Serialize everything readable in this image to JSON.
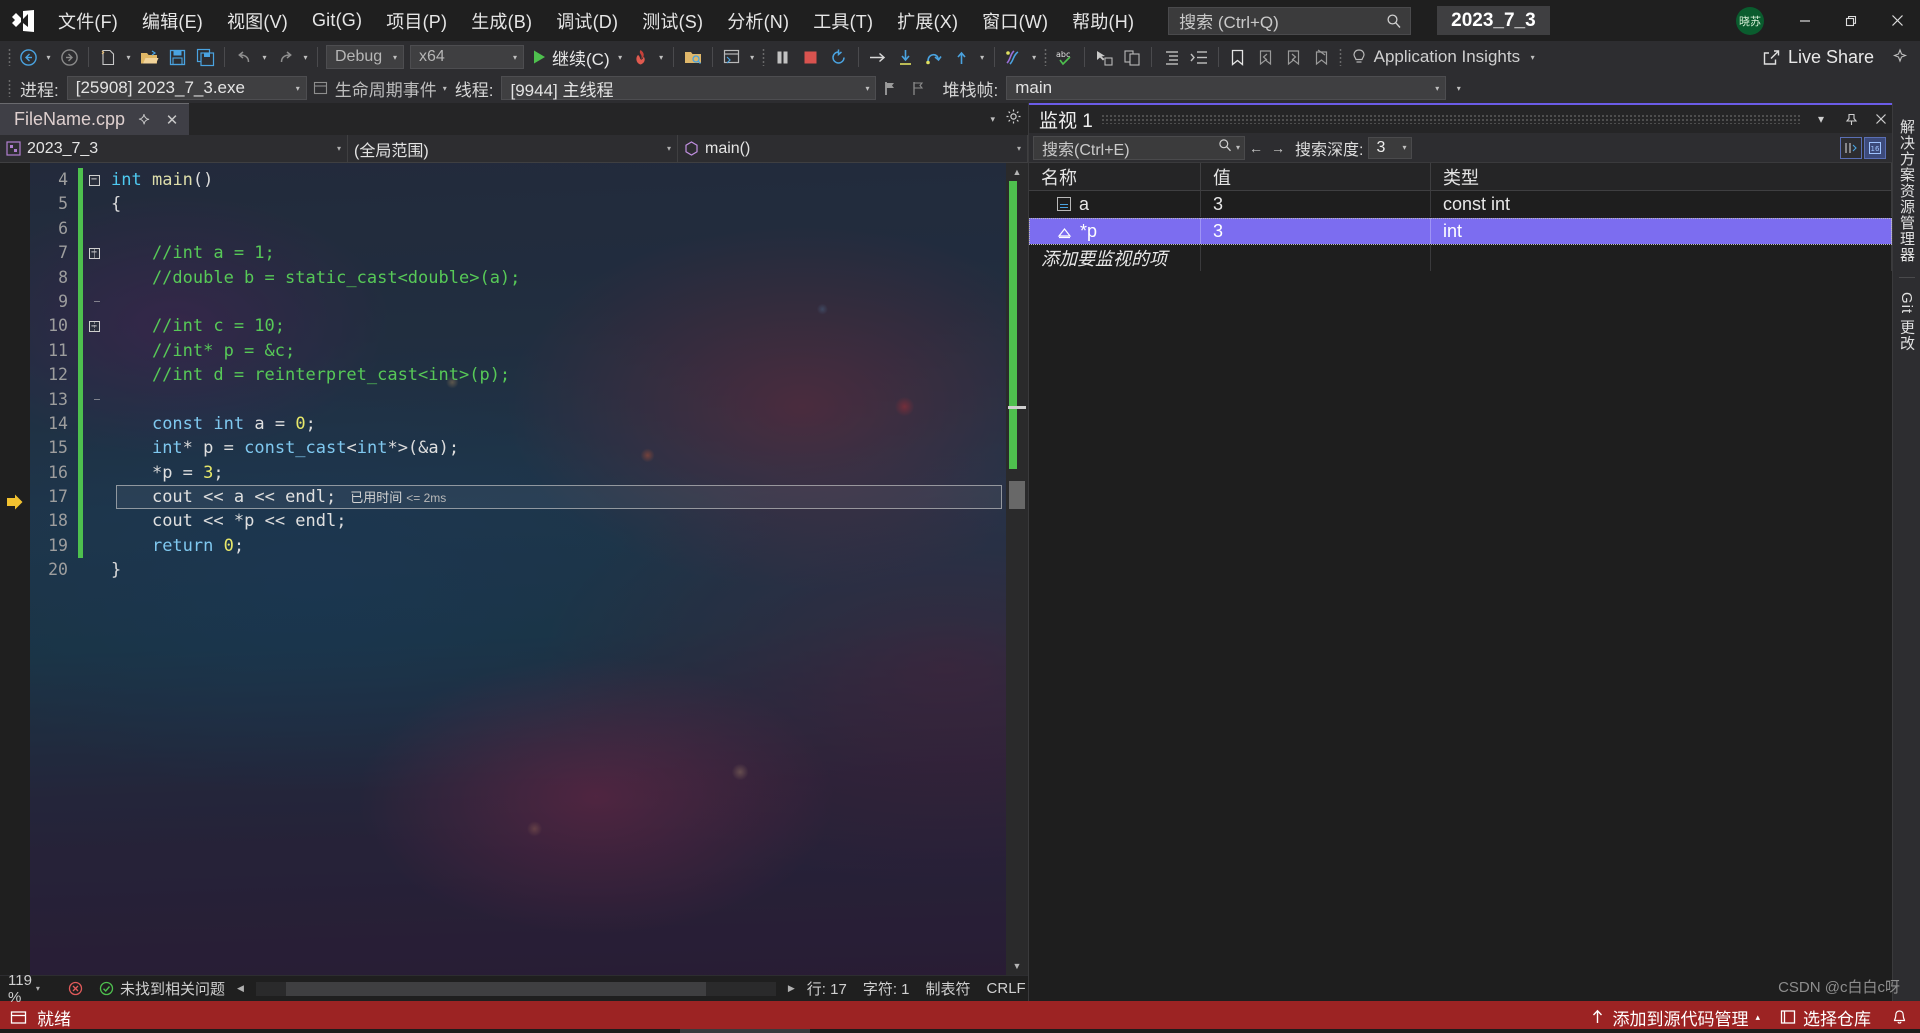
{
  "titlebar": {
    "menus": [
      {
        "label": "文件(F)",
        "name": "menu-file"
      },
      {
        "label": "编辑(E)",
        "name": "menu-edit"
      },
      {
        "label": "视图(V)",
        "name": "menu-view"
      },
      {
        "label": "Git(G)",
        "name": "menu-git"
      },
      {
        "label": "项目(P)",
        "name": "menu-project"
      },
      {
        "label": "生成(B)",
        "name": "menu-build"
      },
      {
        "label": "调试(D)",
        "name": "menu-debug"
      },
      {
        "label": "测试(S)",
        "name": "menu-test"
      },
      {
        "label": "分析(N)",
        "name": "menu-analyze"
      },
      {
        "label": "工具(T)",
        "name": "menu-tools"
      },
      {
        "label": "扩展(X)",
        "name": "menu-extensions"
      },
      {
        "label": "窗口(W)",
        "name": "menu-window"
      },
      {
        "label": "帮助(H)",
        "name": "menu-help"
      }
    ],
    "search_placeholder": "搜索 (Ctrl+Q)",
    "solution_name": "2023_7_3",
    "account_initials": "晓苏",
    "minimize": "—",
    "restore": "❐",
    "close": "✕"
  },
  "toolbar": {
    "configuration": "Debug",
    "platform": "x64",
    "continue_label": "继续(C)",
    "app_insights": "Application Insights",
    "live_share": "Live Share"
  },
  "debugbar": {
    "process_label": "进程:",
    "process_value": "[25908] 2023_7_3.exe",
    "lifecycle_label": "生命周期事件",
    "thread_label": "线程:",
    "thread_value": "[9944] 主线程",
    "stackframe_label": "堆栈帧:",
    "stackframe_value": "main"
  },
  "editor": {
    "tab_title": "FileName.cpp",
    "tab_pin": "⯎",
    "tab_close": "✕",
    "nav_project": "2023_7_3",
    "nav_scope": "(全局范围)",
    "nav_member": "main()",
    "elapsed_prefix": "已用时间",
    "elapsed_value": "<= 2ms",
    "lines": [
      {
        "num": "4",
        "fold": "minus",
        "vline": "none",
        "tokens": [
          {
            "t": "int",
            "c": "k-kw"
          },
          {
            "t": " ",
            "c": "k-plain"
          },
          {
            "t": "main",
            "c": "k-fn"
          },
          {
            "t": "()",
            "c": "k-plain"
          }
        ]
      },
      {
        "num": "5",
        "fold": "line",
        "vline": "solid",
        "tokens": [
          {
            "t": "{",
            "c": "k-plain"
          }
        ]
      },
      {
        "num": "6",
        "fold": "line",
        "vline": "solid",
        "tokens": []
      },
      {
        "num": "7",
        "fold": "minus2",
        "vline": "solid",
        "tokens": [
          {
            "t": "    //int a = 1;",
            "c": "k-cmt"
          }
        ]
      },
      {
        "num": "8",
        "fold": "line",
        "vline": "dashed",
        "tokens": [
          {
            "t": "    //double b = static_cast<double>(a);",
            "c": "k-cmt"
          }
        ]
      },
      {
        "num": "9",
        "fold": "tick",
        "vline": "dashed",
        "tokens": []
      },
      {
        "num": "10",
        "fold": "minus2",
        "vline": "dashed",
        "tokens": [
          {
            "t": "    //int c = 10;",
            "c": "k-cmt"
          }
        ]
      },
      {
        "num": "11",
        "fold": "line",
        "vline": "dashed",
        "tokens": [
          {
            "t": "    //int* p = &c;",
            "c": "k-cmt"
          }
        ]
      },
      {
        "num": "12",
        "fold": "line",
        "vline": "dashed",
        "tokens": [
          {
            "t": "    //int d = reinterpret_cast<int>(p);",
            "c": "k-cmt"
          }
        ]
      },
      {
        "num": "13",
        "fold": "tick",
        "vline": "dashed",
        "tokens": []
      },
      {
        "num": "14",
        "fold": "line",
        "vline": "solid",
        "tokens": [
          {
            "t": "    ",
            "c": "k-plain"
          },
          {
            "t": "const",
            "c": "k-blue"
          },
          {
            "t": " ",
            "c": "k-plain"
          },
          {
            "t": "int",
            "c": "k-blue"
          },
          {
            "t": " ",
            "c": "k-plain"
          },
          {
            "t": "a",
            "c": "k-ident"
          },
          {
            "t": " = ",
            "c": "k-plain"
          },
          {
            "t": "0",
            "c": "k-num"
          },
          {
            "t": ";",
            "c": "k-plain"
          }
        ]
      },
      {
        "num": "15",
        "fold": "line",
        "vline": "solid",
        "tokens": [
          {
            "t": "    ",
            "c": "k-plain"
          },
          {
            "t": "int",
            "c": "k-blue"
          },
          {
            "t": "* ",
            "c": "k-plain"
          },
          {
            "t": "p",
            "c": "k-ident"
          },
          {
            "t": " = ",
            "c": "k-plain"
          },
          {
            "t": "const_cast",
            "c": "k-blue"
          },
          {
            "t": "<",
            "c": "k-plain"
          },
          {
            "t": "int",
            "c": "k-blue"
          },
          {
            "t": "*>(&",
            "c": "k-plain"
          },
          {
            "t": "a",
            "c": "k-ident"
          },
          {
            "t": ");",
            "c": "k-plain"
          }
        ]
      },
      {
        "num": "16",
        "fold": "line",
        "vline": "solid",
        "tokens": [
          {
            "t": "    *",
            "c": "k-plain"
          },
          {
            "t": "p",
            "c": "k-ident"
          },
          {
            "t": " = ",
            "c": "k-plain"
          },
          {
            "t": "3",
            "c": "k-num"
          },
          {
            "t": ";",
            "c": "k-plain"
          }
        ]
      },
      {
        "num": "17",
        "fold": "line",
        "vline": "solid",
        "current": true,
        "tokens": [
          {
            "t": "    ",
            "c": "k-plain"
          },
          {
            "t": "cout",
            "c": "k-ident"
          },
          {
            "t": " << ",
            "c": "k-plain"
          },
          {
            "t": "a",
            "c": "k-ident"
          },
          {
            "t": " << ",
            "c": "k-plain"
          },
          {
            "t": "endl",
            "c": "k-ident"
          },
          {
            "t": ";",
            "c": "k-plain"
          }
        ]
      },
      {
        "num": "18",
        "fold": "line",
        "vline": "solid",
        "tokens": [
          {
            "t": "    ",
            "c": "k-plain"
          },
          {
            "t": "cout",
            "c": "k-ident"
          },
          {
            "t": " << *",
            "c": "k-plain"
          },
          {
            "t": "p",
            "c": "k-ident"
          },
          {
            "t": " << ",
            "c": "k-plain"
          },
          {
            "t": "endl",
            "c": "k-ident"
          },
          {
            "t": ";",
            "c": "k-plain"
          }
        ]
      },
      {
        "num": "19",
        "fold": "line",
        "vline": "solid",
        "tokens": [
          {
            "t": "    ",
            "c": "k-plain"
          },
          {
            "t": "return",
            "c": "k-blue"
          },
          {
            "t": " ",
            "c": "k-plain"
          },
          {
            "t": "0",
            "c": "k-num"
          },
          {
            "t": ";",
            "c": "k-plain"
          }
        ]
      },
      {
        "num": "20",
        "fold": "none",
        "vline": "none",
        "tokens": [
          {
            "t": "}",
            "c": "k-plain"
          }
        ]
      }
    ]
  },
  "editor_status": {
    "zoom": "119 %",
    "issues": "未找到相关问题",
    "line": "行: 17",
    "char": "字符: 1",
    "tabs": "制表符",
    "eol": "CRLF"
  },
  "watch": {
    "title": "监视 1",
    "search_placeholder": "搜索(Ctrl+E)",
    "depth_label": "搜索深度:",
    "depth_value": "3",
    "columns": [
      "名称",
      "值",
      "类型"
    ],
    "rows": [
      {
        "name": "a",
        "value": "3",
        "type": "const int",
        "icon": "equals-icon",
        "selected": false
      },
      {
        "name": "*p",
        "value": "3",
        "type": "int",
        "icon": "pointer-icon",
        "selected": true
      }
    ],
    "add_row_placeholder": "添加要监视的项"
  },
  "right_dock": {
    "tabs": [
      "解决方案资源管理器",
      "Git 更改"
    ]
  },
  "statusbar": {
    "status": "就绪",
    "source_control": "添加到源代码管理",
    "repo": "选择仓库",
    "notifications": "🔔"
  },
  "watermark": "CSDN @c白白c呀",
  "colors": {
    "accent_purple": "#7c6df0",
    "status_red": "#9c2323",
    "change_green": "#4ec04e",
    "comment_green": "#57c957",
    "keyword_blue": "#7fc8ef"
  }
}
